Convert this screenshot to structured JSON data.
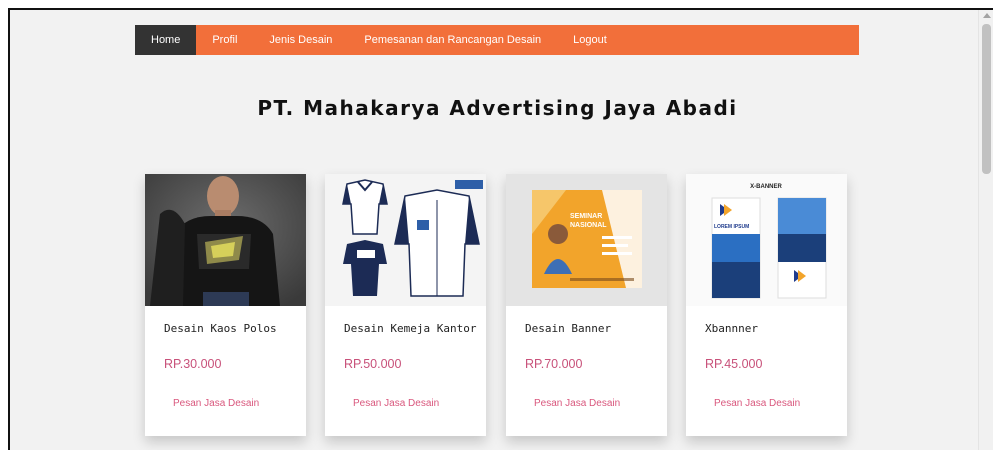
{
  "nav": {
    "items": [
      {
        "label": "Home",
        "active": true
      },
      {
        "label": "Profil",
        "active": false
      },
      {
        "label": "Jenis Desain",
        "active": false
      },
      {
        "label": "Pemesanan dan Rancangan Desain",
        "active": false
      },
      {
        "label": "Logout",
        "active": false
      }
    ]
  },
  "page": {
    "title": "PT. Mahakarya Advertising Jaya Abadi"
  },
  "products": [
    {
      "name": "Desain Kaos Polos",
      "price": "RP.30.000",
      "action": "Pesan Jasa Desain"
    },
    {
      "name": "Desain Kemeja Kantor",
      "price": "RP.50.000",
      "action": "Pesan Jasa Desain"
    },
    {
      "name": "Desain Banner",
      "price": "RP.70.000",
      "action": "Pesan Jasa Desain"
    },
    {
      "name": "Xbannner",
      "price": "RP.45.000",
      "action": "Pesan Jasa Desain"
    }
  ],
  "images": {
    "banner_heading_1": "SEMINAR",
    "banner_heading_2": "NASIONAL",
    "xbanner_label": "X-BANNER",
    "xbanner_text": "LOREM IPSUM"
  },
  "colors": {
    "nav_bg": "#f26f3a",
    "nav_active": "#333333",
    "price": "#c8517a",
    "link": "#d9577d"
  }
}
